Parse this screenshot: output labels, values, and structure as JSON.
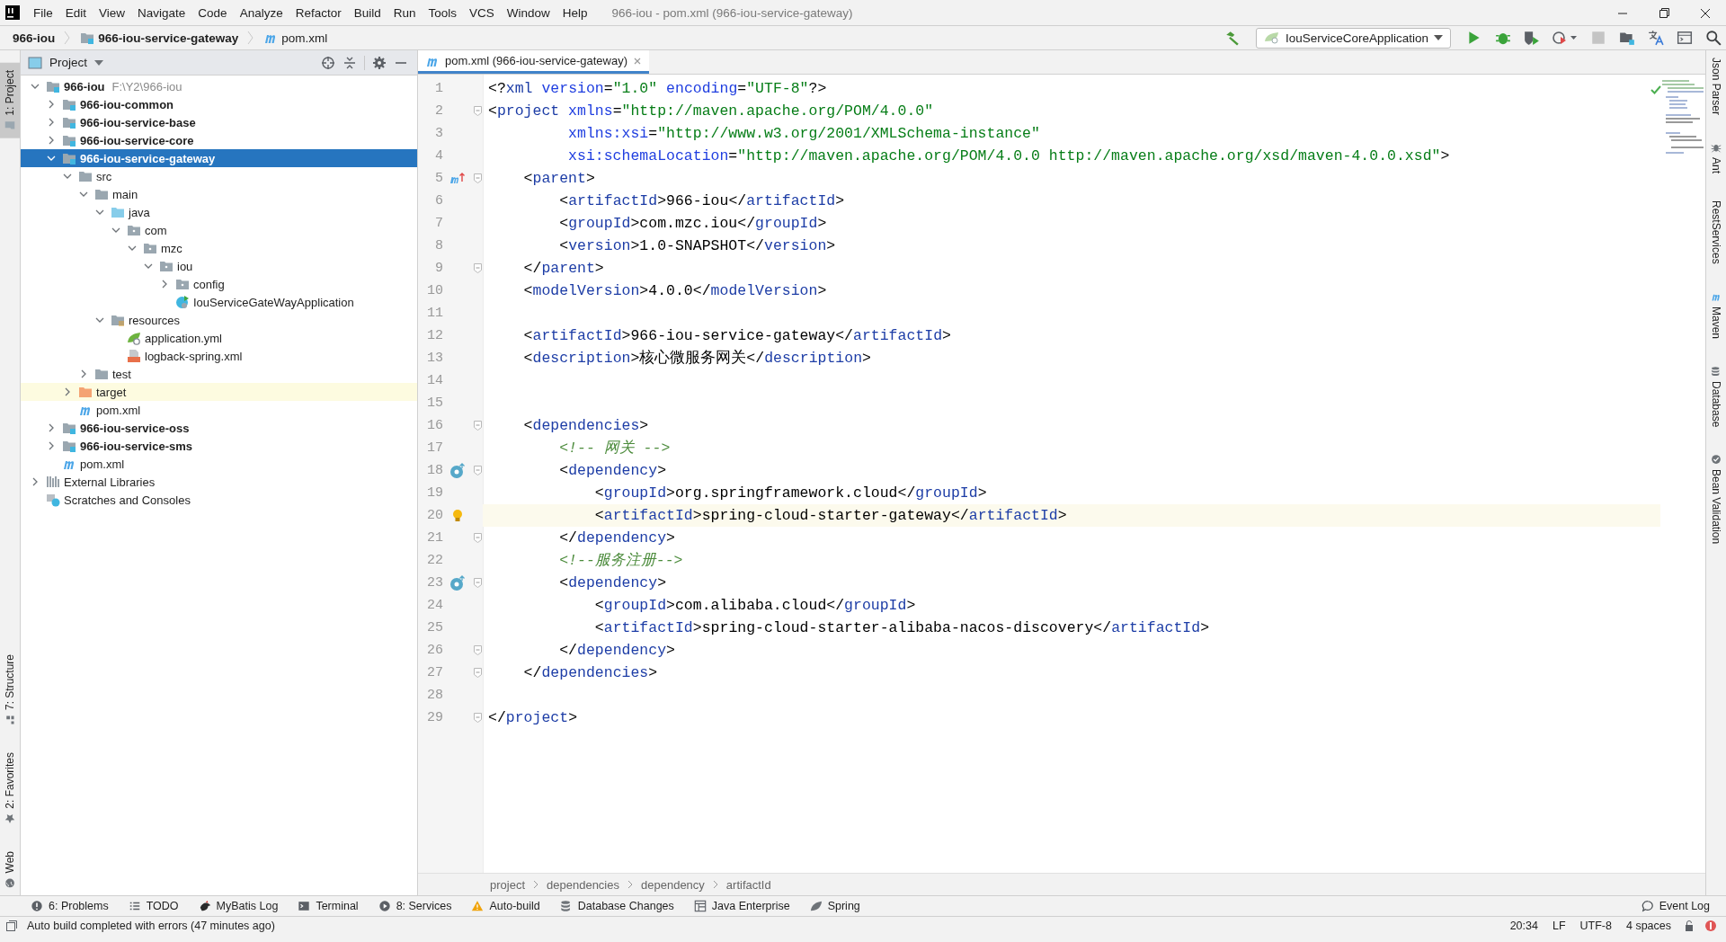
{
  "window": {
    "title": "966-iou - pom.xml (966-iou-service-gateway)"
  },
  "menu": [
    "File",
    "Edit",
    "View",
    "Navigate",
    "Code",
    "Analyze",
    "Refactor",
    "Build",
    "Run",
    "Tools",
    "VCS",
    "Window",
    "Help"
  ],
  "navigation_bar": {
    "crumbs": [
      {
        "label": "966-iou",
        "kind": "project"
      },
      {
        "label": "966-iou-service-gateway",
        "kind": "module"
      },
      {
        "label": "pom.xml",
        "kind": "maven"
      }
    ],
    "run_configuration": "IouServiceCoreApplication"
  },
  "left_tool_strip": {
    "top": [
      {
        "label": "1: Project",
        "kind": "project",
        "selected": true
      }
    ],
    "bottom": [
      {
        "label": "7: Structure",
        "kind": "structure",
        "selected": false
      },
      {
        "label": "2: Favorites",
        "kind": "favorites",
        "selected": false
      },
      {
        "label": "Web",
        "kind": "web",
        "selected": false
      }
    ]
  },
  "project_panel": {
    "title": "Project",
    "tree": [
      {
        "label": "966-iou",
        "detail": "F:\\Y2\\966-iou",
        "kind": "module",
        "expanded": true,
        "selected": false,
        "children": [
          {
            "label": "966-iou-common",
            "kind": "module",
            "expanded": false,
            "selected": false
          },
          {
            "label": "966-iou-service-base",
            "kind": "module",
            "expanded": false,
            "selected": false
          },
          {
            "label": "966-iou-service-core",
            "kind": "module",
            "expanded": false,
            "selected": false
          },
          {
            "label": "966-iou-service-gateway",
            "kind": "module",
            "expanded": true,
            "selected": true,
            "children": [
              {
                "label": "src",
                "kind": "folder",
                "expanded": true,
                "selected": false,
                "children": [
                  {
                    "label": "main",
                    "kind": "folder",
                    "expanded": true,
                    "selected": false,
                    "children": [
                      {
                        "label": "java",
                        "kind": "source-folder",
                        "expanded": true,
                        "selected": false,
                        "children": [
                          {
                            "label": "com",
                            "kind": "package",
                            "expanded": true,
                            "selected": false,
                            "children": [
                              {
                                "label": "mzc",
                                "kind": "package",
                                "expanded": true,
                                "selected": false,
                                "children": [
                                  {
                                    "label": "iou",
                                    "kind": "package",
                                    "expanded": true,
                                    "selected": false,
                                    "children": [
                                      {
                                        "label": "config",
                                        "kind": "package",
                                        "expanded": false,
                                        "selected": false
                                      },
                                      {
                                        "label": "IouServiceGateWayApplication",
                                        "kind": "spring-class",
                                        "selected": false
                                      }
                                    ]
                                  }
                                ]
                              }
                            ]
                          }
                        ]
                      },
                      {
                        "label": "resources",
                        "kind": "resources-folder",
                        "expanded": true,
                        "selected": false,
                        "children": [
                          {
                            "label": "application.yml",
                            "kind": "yml",
                            "selected": false
                          },
                          {
                            "label": "logback-spring.xml",
                            "kind": "xml",
                            "selected": false
                          }
                        ]
                      }
                    ]
                  },
                  {
                    "label": "test",
                    "kind": "folder",
                    "expanded": false,
                    "selected": false
                  }
                ]
              },
              {
                "label": "target",
                "kind": "excluded-folder",
                "expanded": false,
                "selected": false
              },
              {
                "label": "pom.xml",
                "kind": "maven",
                "selected": false
              }
            ]
          },
          {
            "label": "966-iou-service-oss",
            "kind": "module",
            "expanded": false,
            "selected": false
          },
          {
            "label": "966-iou-service-sms",
            "kind": "module",
            "expanded": false,
            "selected": false
          },
          {
            "label": "pom.xml",
            "kind": "maven",
            "selected": false
          }
        ]
      },
      {
        "label": "External Libraries",
        "kind": "libraries",
        "expanded": false,
        "selected": false
      },
      {
        "label": "Scratches and Consoles",
        "kind": "scratches",
        "selected": false
      }
    ]
  },
  "editor": {
    "tabs": [
      {
        "label": "pom.xml (966-iou-service-gateway)",
        "kind": "maven",
        "selected": true
      }
    ],
    "lines": [
      {
        "number": "1",
        "kind": "code",
        "fold": false,
        "current": false,
        "tokens": [
          {
            "kind": "p",
            "text": "<?"
          },
          {
            "kind": "tag",
            "text": "xml"
          },
          {
            "kind": "attr",
            "text": " version"
          },
          {
            "kind": "p",
            "text": "="
          },
          {
            "kind": "value",
            "text": "\"1.0\""
          },
          {
            "kind": "attr",
            "text": " encoding"
          },
          {
            "kind": "p",
            "text": "="
          },
          {
            "kind": "value",
            "text": "\"UTF-8\""
          },
          {
            "kind": "p",
            "text": "?>"
          }
        ]
      },
      {
        "number": "2",
        "kind": "code",
        "fold": true,
        "current": false,
        "tokens": [
          {
            "kind": "p",
            "text": "<"
          },
          {
            "kind": "tag",
            "text": "project"
          },
          {
            "kind": "attr",
            "text": " xmlns"
          },
          {
            "kind": "p",
            "text": "="
          },
          {
            "kind": "value",
            "text": "\"http://maven.apache.org/POM/4.0.0\""
          }
        ]
      },
      {
        "number": "3",
        "kind": "code",
        "fold": false,
        "current": false,
        "tokens": [
          {
            "kind": "attr",
            "text": "         xmlns:xsi"
          },
          {
            "kind": "p",
            "text": "="
          },
          {
            "kind": "value",
            "text": "\"http://www.w3.org/2001/XMLSchema-instance\""
          }
        ]
      },
      {
        "number": "4",
        "kind": "code",
        "fold": false,
        "current": false,
        "tokens": [
          {
            "kind": "attr",
            "text": "         xsi:schemaLocation"
          },
          {
            "kind": "p",
            "text": "="
          },
          {
            "kind": "value",
            "text": "\"http://maven.apache.org/POM/4.0.0 http://maven.apache.org/xsd/maven-4.0.0.xsd\""
          },
          {
            "kind": "p",
            "text": ">"
          }
        ]
      },
      {
        "number": "5",
        "kind": "parent-link",
        "fold": true,
        "current": false,
        "tokens": [
          {
            "kind": "p",
            "text": "    <"
          },
          {
            "kind": "tag",
            "text": "parent"
          },
          {
            "kind": "p",
            "text": ">"
          }
        ]
      },
      {
        "number": "6",
        "kind": "code",
        "fold": false,
        "current": false,
        "tokens": [
          {
            "kind": "p",
            "text": "        <"
          },
          {
            "kind": "tag",
            "text": "artifactId"
          },
          {
            "kind": "p",
            "text": ">"
          },
          {
            "kind": "text",
            "text": "966-iou"
          },
          {
            "kind": "p",
            "text": "</"
          },
          {
            "kind": "tag",
            "text": "artifactId"
          },
          {
            "kind": "p",
            "text": ">"
          }
        ]
      },
      {
        "number": "7",
        "kind": "code",
        "fold": false,
        "current": false,
        "tokens": [
          {
            "kind": "p",
            "text": "        <"
          },
          {
            "kind": "tag",
            "text": "groupId"
          },
          {
            "kind": "p",
            "text": ">"
          },
          {
            "kind": "text",
            "text": "com.mzc.iou"
          },
          {
            "kind": "p",
            "text": "</"
          },
          {
            "kind": "tag",
            "text": "groupId"
          },
          {
            "kind": "p",
            "text": ">"
          }
        ]
      },
      {
        "number": "8",
        "kind": "code",
        "fold": false,
        "current": false,
        "tokens": [
          {
            "kind": "p",
            "text": "        <"
          },
          {
            "kind": "tag",
            "text": "version"
          },
          {
            "kind": "p",
            "text": ">"
          },
          {
            "kind": "text",
            "text": "1.0-SNAPSHOT"
          },
          {
            "kind": "p",
            "text": "</"
          },
          {
            "kind": "tag",
            "text": "version"
          },
          {
            "kind": "p",
            "text": ">"
          }
        ]
      },
      {
        "number": "9",
        "kind": "code",
        "fold": true,
        "current": false,
        "tokens": [
          {
            "kind": "p",
            "text": "    </"
          },
          {
            "kind": "tag",
            "text": "parent"
          },
          {
            "kind": "p",
            "text": ">"
          }
        ]
      },
      {
        "number": "10",
        "kind": "code",
        "fold": false,
        "current": false,
        "tokens": [
          {
            "kind": "p",
            "text": "    <"
          },
          {
            "kind": "tag",
            "text": "modelVersion"
          },
          {
            "kind": "p",
            "text": ">"
          },
          {
            "kind": "text",
            "text": "4.0.0"
          },
          {
            "kind": "p",
            "text": "</"
          },
          {
            "kind": "tag",
            "text": "modelVersion"
          },
          {
            "kind": "p",
            "text": ">"
          }
        ]
      },
      {
        "number": "11",
        "kind": "code",
        "fold": false,
        "current": false
      },
      {
        "number": "12",
        "kind": "code",
        "fold": false,
        "current": false,
        "tokens": [
          {
            "kind": "p",
            "text": "    <"
          },
          {
            "kind": "tag",
            "text": "artifactId"
          },
          {
            "kind": "p",
            "text": ">"
          },
          {
            "kind": "text",
            "text": "966-iou-service-gateway"
          },
          {
            "kind": "p",
            "text": "</"
          },
          {
            "kind": "tag",
            "text": "artifactId"
          },
          {
            "kind": "p",
            "text": ">"
          }
        ]
      },
      {
        "number": "13",
        "kind": "code",
        "fold": false,
        "current": false,
        "tokens": [
          {
            "kind": "p",
            "text": "    <"
          },
          {
            "kind": "tag",
            "text": "description"
          },
          {
            "kind": "p",
            "text": ">"
          },
          {
            "kind": "text",
            "text": "核心微服务网关"
          },
          {
            "kind": "p",
            "text": "</"
          },
          {
            "kind": "tag",
            "text": "description"
          },
          {
            "kind": "p",
            "text": ">"
          }
        ]
      },
      {
        "number": "14",
        "kind": "code",
        "fold": false,
        "current": false
      },
      {
        "number": "15",
        "kind": "code",
        "fold": false,
        "current": false
      },
      {
        "number": "16",
        "kind": "code",
        "fold": true,
        "current": false,
        "tokens": [
          {
            "kind": "p",
            "text": "    <"
          },
          {
            "kind": "tag",
            "text": "dependencies"
          },
          {
            "kind": "p",
            "text": ">"
          }
        ]
      },
      {
        "number": "17",
        "kind": "code",
        "fold": false,
        "current": false,
        "tokens": [
          {
            "kind": "comment",
            "text": "        <!-- 网关 -->"
          }
        ]
      },
      {
        "number": "18",
        "kind": "bean",
        "fold": true,
        "current": false,
        "tokens": [
          {
            "kind": "p",
            "text": "        <"
          },
          {
            "kind": "tag",
            "text": "dependency"
          },
          {
            "kind": "p",
            "text": ">"
          }
        ]
      },
      {
        "number": "19",
        "kind": "code",
        "fold": false,
        "current": false,
        "tokens": [
          {
            "kind": "p",
            "text": "            <"
          },
          {
            "kind": "tag",
            "text": "groupId"
          },
          {
            "kind": "p",
            "text": ">"
          },
          {
            "kind": "text",
            "text": "org.springframework.cloud"
          },
          {
            "kind": "p",
            "text": "</"
          },
          {
            "kind": "tag",
            "text": "groupId"
          },
          {
            "kind": "p",
            "text": ">"
          }
        ]
      },
      {
        "number": "20",
        "kind": "bulb",
        "fold": false,
        "current": true,
        "tokens": [
          {
            "kind": "p",
            "text": "            <"
          },
          {
            "kind": "tag",
            "text": "artifactId"
          },
          {
            "kind": "p",
            "text": ">"
          },
          {
            "kind": "text",
            "text": "spring-cloud-starter-gateway"
          },
          {
            "kind": "p",
            "text": "</"
          },
          {
            "kind": "tag",
            "text": "artifactId"
          },
          {
            "kind": "p",
            "text": ">"
          }
        ]
      },
      {
        "number": "21",
        "kind": "code",
        "fold": true,
        "current": false,
        "tokens": [
          {
            "kind": "p",
            "text": "        </"
          },
          {
            "kind": "tag",
            "text": "dependency"
          },
          {
            "kind": "p",
            "text": ">"
          }
        ]
      },
      {
        "number": "22",
        "kind": "code",
        "fold": false,
        "current": false,
        "tokens": [
          {
            "kind": "comment",
            "text": "        <!--服务注册-->"
          }
        ]
      },
      {
        "number": "23",
        "kind": "bean",
        "fold": true,
        "current": false,
        "tokens": [
          {
            "kind": "p",
            "text": "        <"
          },
          {
            "kind": "tag",
            "text": "dependency"
          },
          {
            "kind": "p",
            "text": ">"
          }
        ]
      },
      {
        "number": "24",
        "kind": "code",
        "fold": false,
        "current": false,
        "tokens": [
          {
            "kind": "p",
            "text": "            <"
          },
          {
            "kind": "tag",
            "text": "groupId"
          },
          {
            "kind": "p",
            "text": ">"
          },
          {
            "kind": "text",
            "text": "com.alibaba.cloud"
          },
          {
            "kind": "p",
            "text": "</"
          },
          {
            "kind": "tag",
            "text": "groupId"
          },
          {
            "kind": "p",
            "text": ">"
          }
        ]
      },
      {
        "number": "25",
        "kind": "code",
        "fold": false,
        "current": false,
        "tokens": [
          {
            "kind": "p",
            "text": "            <"
          },
          {
            "kind": "tag",
            "text": "artifactId"
          },
          {
            "kind": "p",
            "text": ">"
          },
          {
            "kind": "text",
            "text": "spring-cloud-starter-alibaba-nacos-discovery"
          },
          {
            "kind": "p",
            "text": "</"
          },
          {
            "kind": "tag",
            "text": "artifactId"
          },
          {
            "kind": "p",
            "text": ">"
          }
        ]
      },
      {
        "number": "26",
        "kind": "code",
        "fold": true,
        "current": false,
        "tokens": [
          {
            "kind": "p",
            "text": "        </"
          },
          {
            "kind": "tag",
            "text": "dependency"
          },
          {
            "kind": "p",
            "text": ">"
          }
        ]
      },
      {
        "number": "27",
        "kind": "code",
        "fold": true,
        "current": false,
        "tokens": [
          {
            "kind": "p",
            "text": "    </"
          },
          {
            "kind": "tag",
            "text": "dependencies"
          },
          {
            "kind": "p",
            "text": ">"
          }
        ]
      },
      {
        "number": "28",
        "kind": "code",
        "fold": false,
        "current": false
      },
      {
        "number": "29",
        "kind": "code",
        "fold": true,
        "current": false,
        "tokens": [
          {
            "kind": "p",
            "text": "</"
          },
          {
            "kind": "tag",
            "text": "project"
          },
          {
            "kind": "p",
            "text": ">"
          }
        ]
      }
    ],
    "breadcrumbs": [
      "project",
      "dependencies",
      "dependency",
      "artifactId"
    ]
  },
  "right_tool_strip": [
    {
      "label": "Json Parser",
      "kind": "plain"
    },
    {
      "label": "Ant",
      "kind": "ant"
    },
    {
      "label": "RestServices",
      "kind": "plain"
    },
    {
      "label": "Maven",
      "kind": "maven"
    },
    {
      "label": "Database",
      "kind": "database"
    },
    {
      "label": "Bean Validation",
      "kind": "bean"
    }
  ],
  "bottom_tool_strip": [
    {
      "label": "6: Problems",
      "kind": "problems"
    },
    {
      "label": "TODO",
      "kind": "todo"
    },
    {
      "label": "MyBatis Log",
      "kind": "mybatis"
    },
    {
      "label": "Terminal",
      "kind": "terminal"
    },
    {
      "label": "8: Services",
      "kind": "services"
    },
    {
      "label": "Auto-build",
      "kind": "warning"
    },
    {
      "label": "Database Changes",
      "kind": "database"
    },
    {
      "label": "Java Enterprise",
      "kind": "enterprise"
    },
    {
      "label": "Spring",
      "kind": "spring"
    }
  ],
  "event_log": "Event Log",
  "status_bar": {
    "message": "Auto build completed with errors (47 minutes ago)",
    "position": "20:34",
    "line_separator": "LF",
    "encoding": "UTF-8",
    "indent": "4 spaces"
  }
}
